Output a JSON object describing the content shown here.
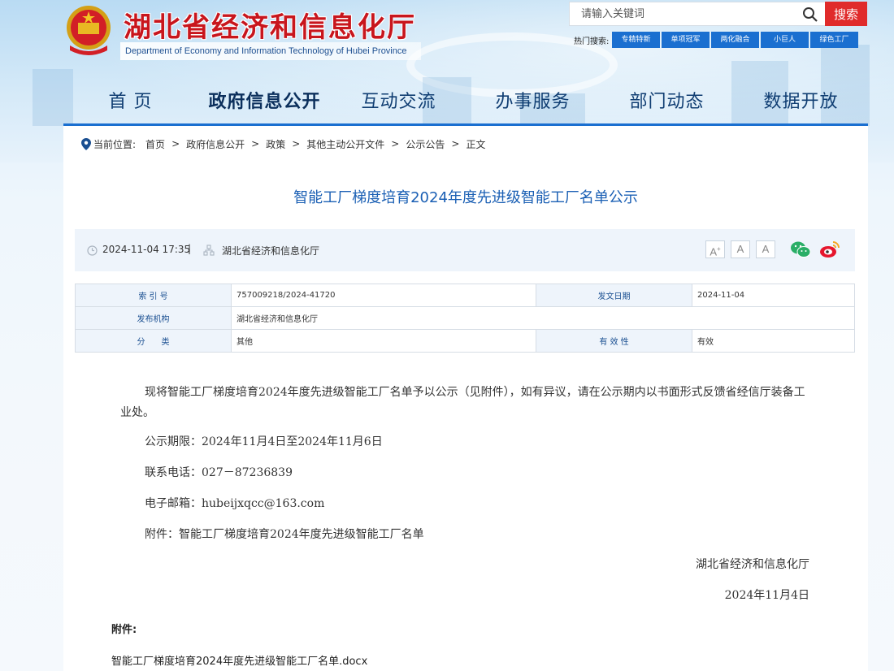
{
  "header": {
    "site_title": "湖北省经济和信息化厅",
    "site_subtitle": "Department of Economy and Information Technology of Hubei Province",
    "search": {
      "placeholder": "请输入关键词",
      "button_label": "搜索"
    },
    "hot_search": {
      "label": "热门搜索:",
      "tags": [
        "专精特新",
        "单项冠军",
        "两化融合",
        "小巨人",
        "绿色工厂"
      ]
    }
  },
  "nav": {
    "items": [
      "首 页",
      "政府信息公开",
      "互动交流",
      "办事服务",
      "部门动态",
      "数据开放"
    ],
    "active_index": 1
  },
  "breadcrumb": {
    "label": "当前位置:",
    "items": [
      "首页",
      "政府信息公开",
      "政策",
      "其他主动公开文件",
      "公示公告",
      "正文"
    ],
    "separator": ">"
  },
  "article": {
    "title": "智能工厂梯度培育2024年度先进级智能工厂名单公示",
    "date": "2024-11-04 17:35",
    "meta_separator": "|",
    "publisher": "湖北省经济和信息化厅",
    "font_size_buttons": [
      "A+",
      "A",
      "A"
    ],
    "share_icons": [
      "wechat-icon",
      "weibo-icon"
    ]
  },
  "info_table": {
    "index_label": "索 引 号",
    "index_value": "757009218/2024-41720",
    "issue_date_label": "发文日期",
    "issue_date_value": "2024-11-04",
    "org_label": "发布机构",
    "org_value": "湖北省经济和信息化厅",
    "category_label": "分　　类",
    "category_value": "其他",
    "validity_label": "有 效 性",
    "validity_value": "有效"
  },
  "content": {
    "paragraph": "现将智能工厂梯度培育2024年度先进级智能工厂名单予以公示（见附件），如有异议，请在公示期内以书面形式反馈省经信厅装备工业处。",
    "period": "公示期限：2024年11月4日至2024年11月6日",
    "phone": "联系电话：027－87236839",
    "email": "电子邮箱：hubeijxqcc@163.com",
    "attachment_line": "附件：智能工厂梯度培育2024年度先进级智能工厂名单",
    "signature_org": "湖北省经济和信息化厅",
    "signature_date": "2024年11月4日"
  },
  "attachments": {
    "heading": "附件:",
    "files": [
      "智能工厂梯度培育2024年度先进级智能工厂名单.docx"
    ]
  },
  "colors": {
    "brand_red": "#c8161d",
    "nav_blue": "#0f3d72",
    "link_blue": "#1a5fb4",
    "tag_blue": "#1a6fd0",
    "search_red": "#e02b2b"
  }
}
